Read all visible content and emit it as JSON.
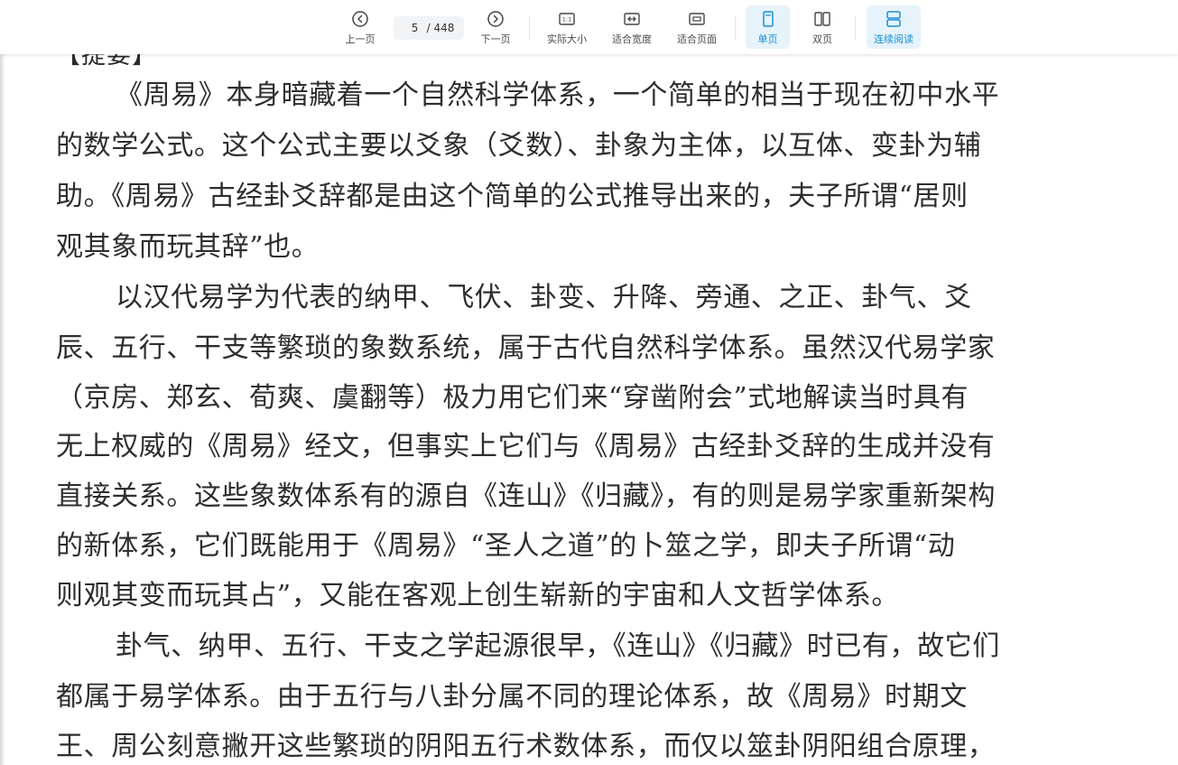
{
  "toolbar": {
    "prev_label": "上一页",
    "page_current": "5",
    "page_total": "/ 448",
    "next_label": "下一页",
    "actual_size_label": "实际大小",
    "fit_width_label": "适合宽度",
    "fit_page_label": "适合页面",
    "single_label": "单页",
    "double_label": "双页",
    "continuous_label": "连续阅读",
    "actual_size_glyph": "1:1",
    "accent_color": "#1a8fd0"
  },
  "document": {
    "partial_heading": "【提要】",
    "lines": [
      "《周易》本身暗藏着一个自然科学体系，一个简单的相当于现在初中水平",
      "的数学公式。这个公式主要以爻象（爻数）、卦象为主体，以互体、变卦为辅",
      "助。《周易》古经卦爻辞都是由这个简单的公式推导出来的，夫子所谓“居则",
      "观其象而玩其辞”也。",
      "以汉代易学为代表的纳甲、飞伏、卦变、升降、旁通、之正、卦气、爻",
      "辰、五行、干支等繁琐的象数系统，属于古代自然科学体系。虽然汉代易学家",
      "（京房、郑玄、荀爽、虞翻等）极力用它们来“穿凿附会”式地解读当时具有",
      "无上权威的《周易》经文，但事实上它们与《周易》古经卦爻辞的生成并没有",
      "直接关系。这些象数体系有的源自《连山》《归藏》，有的则是易学家重新架构",
      "的新体系，它们既能用于《周易》“圣人之道”的卜筮之学，即夫子所谓“动",
      "则观其变而玩其占”，又能在客观上创生崭新的宇宙和人文哲学体系。",
      "卦气、纳甲、五行、干支之学起源很早，《连山》《归藏》时已有，故它们",
      "都属于易学体系。由于五行与八卦分属不同的理论体系，故《周易》时期文",
      "王、周公刻意撇开这些繁琐的阴阳五行术数体系，而仅以筮卦阴阳组合原理，"
    ]
  }
}
